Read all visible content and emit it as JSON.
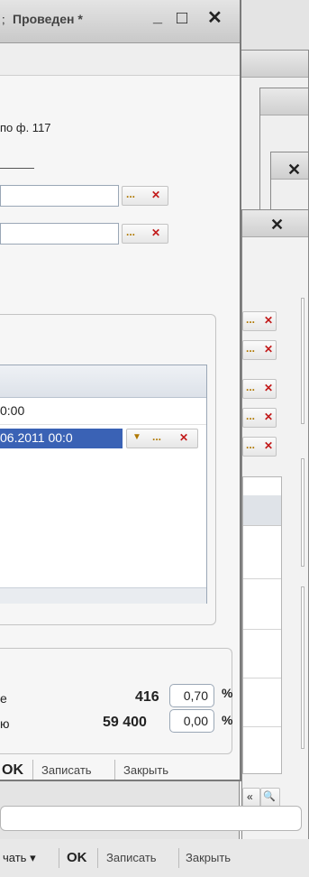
{
  "main": {
    "title_suffix": ";",
    "status": "Проведен",
    "status_mark": "*",
    "minimize_glyph": "_",
    "maximize_glyph": "□",
    "close_glyph": "✕",
    "form_ref": "по ф. 117",
    "dots": "...",
    "clear": "✕",
    "table_row1": "0:00",
    "table_row2": "06.2011 00:0",
    "dropdown_glyph": "▼",
    "amount1_label": "е",
    "amount1": "416",
    "rate1": "0,70",
    "pct": "%",
    "amount2_label": "ю",
    "amount2": "59 400",
    "rate2": "0,00",
    "ok_label": "OK",
    "save_label": "Записать",
    "close_label": "Закрыть"
  },
  "back": {
    "close_glyph": "✕",
    "print_label": "чать",
    "print_arrow": "▾",
    "ok_label": "OK",
    "save_label": "Записать",
    "close_label": "Закрыть",
    "search_glyph": "🔍",
    "left_glyph": "«"
  },
  "colors": {
    "selection": "#3a62b5",
    "titlebar": "#d6d6d6",
    "accent_orange": "#b07800",
    "clear_red": "#c21a1a"
  }
}
